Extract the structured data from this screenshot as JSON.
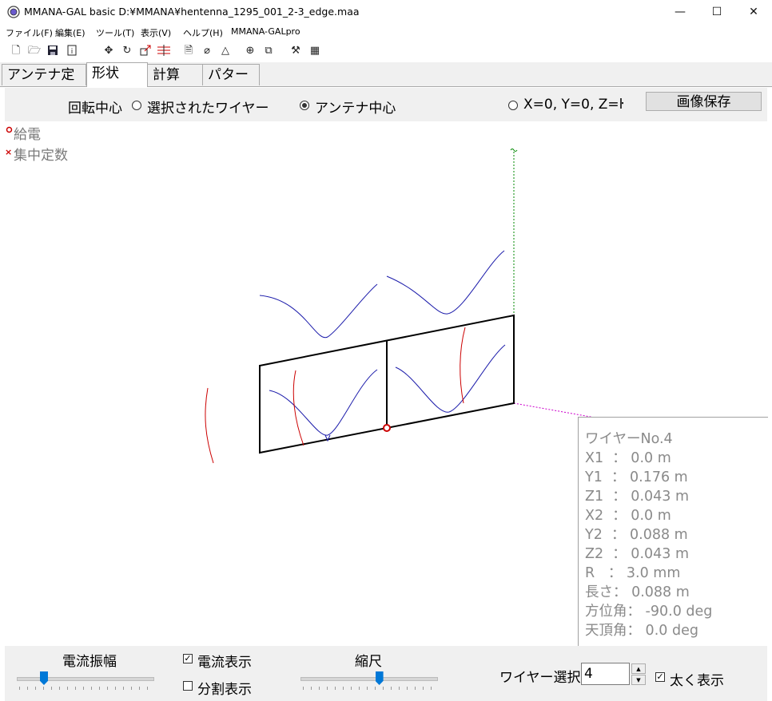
{
  "window": {
    "title": "MMANA-GAL basic D:¥MMANA¥hentenna_1295_001_2-3_edge.maa",
    "minimize": "—",
    "maximize": "☐",
    "close": "✕"
  },
  "menu": [
    "ファイル(F)",
    "編集(E)",
    "ツール(T)",
    "表示(V)",
    "ヘルプ(H)",
    "MMANA-GALpro"
  ],
  "toolbar": [
    "new-icon",
    "open-icon",
    "save-icon",
    "info-icon",
    "move-icon",
    "rotate-icon",
    "resize-icon",
    "segment-icon",
    "document-icon",
    "eraser-icon",
    "triangle-icon",
    "target-icon",
    "copy-icon",
    "tools-icon",
    "calculator-icon"
  ],
  "tabs": [
    {
      "label": "アンテナ定義",
      "active": false
    },
    {
      "label": "形状",
      "active": true
    },
    {
      "label": "計算",
      "active": false
    },
    {
      "label": "パターン",
      "active": false
    }
  ],
  "options": {
    "rotation_center_label": "回転中心",
    "radio_selected_wire": "選択されたワイヤー",
    "radio_antenna_center": "アンテナ中心",
    "radio_origin": "X=0, Y=0, Z=ŀ",
    "selected": "antenna_center",
    "save_image_button": "画像保存"
  },
  "legend": {
    "feed": "給電",
    "lumped": "集中定数",
    "feed_color": "#cc0000",
    "lumped_color": "#cc0000"
  },
  "wire_info": {
    "title": "ワイヤーNo.4",
    "lines": [
      "X1  ： 0.0 m",
      "Y1  ： 0.176 m",
      "Z1  ： 0.043 m",
      "X2  ： 0.0 m",
      "Y2  ： 0.088 m",
      "Z2  ： 0.043 m",
      "R   ： 3.0 mm",
      "長さ： 0.088 m",
      "方位角： -90.0 deg",
      "天頂角： 0.0 deg"
    ]
  },
  "bottom": {
    "current_amplitude_label": "電流振幅",
    "current_amplitude_level": 0.2,
    "show_current_label": "電流表示",
    "show_current_checked": true,
    "show_segments_label": "分割表示",
    "show_segments_checked": false,
    "scale_label": "縮尺",
    "scale_level": 0.58,
    "wire_select_label": "ワイヤー選択",
    "wire_select_value": "4",
    "bold_display_label": "太く表示",
    "bold_display_checked": true
  },
  "colors": {
    "wire": "#000000",
    "current": "#1a1aaa",
    "phase": "#cc0000",
    "z_axis": "#008800",
    "x_axis": "#cc00cc",
    "accent": "#0078d7"
  }
}
